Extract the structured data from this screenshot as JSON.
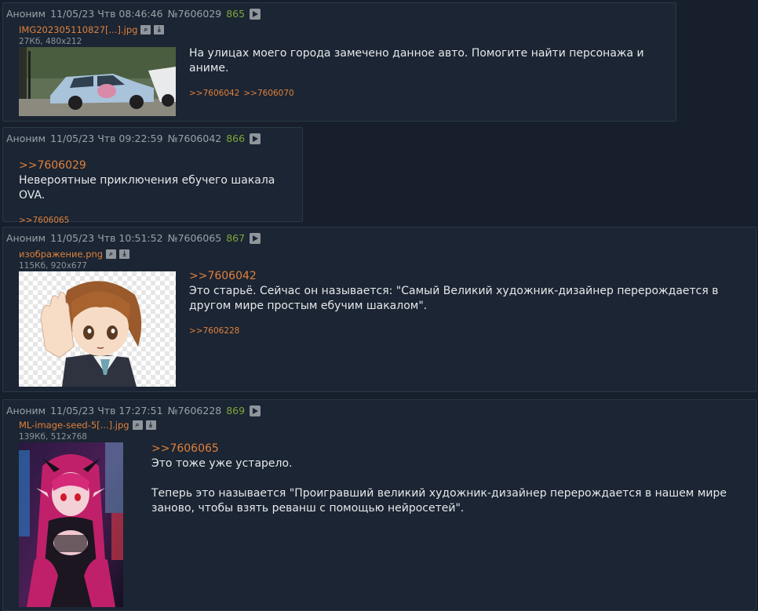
{
  "posts": [
    {
      "author": "Аноним",
      "date": "11/05/23 Чтв 08:46:46",
      "number": "№7606029",
      "count": "865",
      "file": {
        "name": "IMG202305110827[...].jpg",
        "meta": "27Кб, 480x212"
      },
      "quote": "",
      "text": "На улицах моего города замечено данное авто. Помогите найти персонажа и аниме.",
      "replies": [
        ">>7606042",
        ">>7606070"
      ]
    },
    {
      "author": "Аноним",
      "date": "11/05/23 Чтв 09:22:59",
      "number": "№7606042",
      "count": "866",
      "quote": ">>7606029",
      "text": "Невероятные приключения ебучего шакала OVA.",
      "replies": [
        ">>7606065"
      ]
    },
    {
      "author": "Аноним",
      "date": "11/05/23 Чтв 10:51:52",
      "number": "№7606065",
      "count": "867",
      "file": {
        "name": "изображение.png",
        "meta": "115Кб, 920x677"
      },
      "quote": ">>7606042",
      "text": "Это старьё. Сейчас он называется: \"Самый Великий художник-дизайнер перерождается в другом мире простым ебучим шакалом\".",
      "replies": [
        ">>7606228"
      ]
    },
    {
      "author": "Аноним",
      "date": "11/05/23 Чтв 17:27:51",
      "number": "№7606228",
      "count": "869",
      "file": {
        "name": "ML-image-seed-5[...].jpg",
        "meta": "139Кб, 512x768"
      },
      "quote": ">>7606065",
      "text": "Это тоже уже устарело.",
      "text2": "Теперь это называется \"Проигравший великий художник-дизайнер перерождается в нашем мире заново, чтобы взять реванш с помощью нейросетей\"."
    }
  ],
  "icons": {
    "play": "play-icon",
    "search": "search-icon",
    "download": "download-icon"
  },
  "colors": {
    "background": "#161f2b",
    "post_bg": "#1b2533",
    "link": "#e0803a",
    "count": "#7ea63c"
  }
}
